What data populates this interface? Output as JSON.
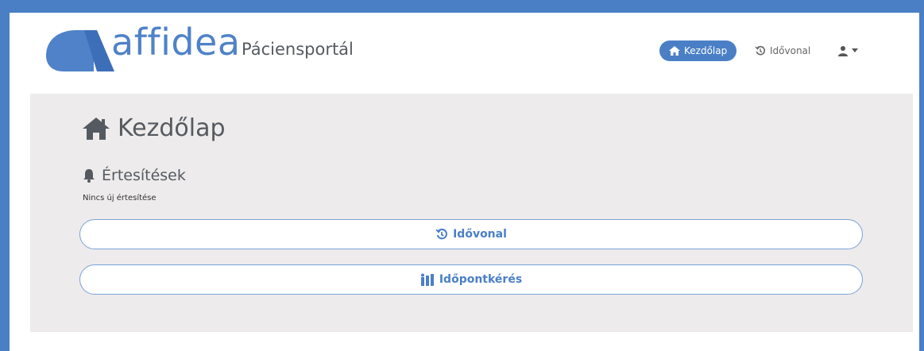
{
  "header": {
    "brand_word": "affidea",
    "brand_sub": "Páciensportál"
  },
  "nav": {
    "home_label": "Kezdőlap",
    "home_icon": "home-icon",
    "timeline_label": "Idővonal",
    "timeline_icon": "history-icon",
    "user_icon": "user-icon"
  },
  "main": {
    "title": "Kezdőlap",
    "notifications": {
      "title": "Értesítések",
      "empty_message": "Nincs új értesítése"
    },
    "buttons": [
      {
        "label": "Idővonal",
        "icon": "history-icon"
      },
      {
        "label": "Időpontkérés",
        "icon": "appointment-icon"
      }
    ]
  },
  "colors": {
    "accent": "#4a7fc6",
    "panel_bg": "#edebeb"
  }
}
